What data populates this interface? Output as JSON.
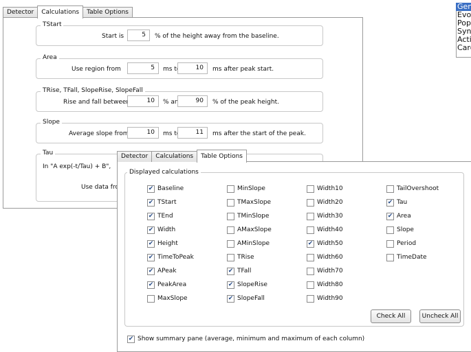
{
  "window1": {
    "tabs": [
      "Detector",
      "Calculations",
      "Table Options"
    ],
    "active_tab": 1,
    "groups": {
      "tstart": {
        "title": "TStart",
        "prefix": "Start is",
        "value": "5",
        "suffix": "% of the height away from the baseline."
      },
      "area": {
        "title": "Area",
        "prefix": "Use region from",
        "value1": "5",
        "middle": "ms to",
        "value2": "10",
        "suffix": "ms after peak start."
      },
      "trise": {
        "title": "TRise, TFall, SlopeRise, SlopeFall",
        "prefix": "Rise and fall between",
        "value1": "10",
        "middle": "% and",
        "value2": "90",
        "suffix": "% of the peak height."
      },
      "slope": {
        "title": "Slope",
        "prefix": "Average slope from",
        "value1": "10",
        "middle": "ms to",
        "value2": "11",
        "suffix": "ms after the start of the peak."
      },
      "tau": {
        "title": "Tau",
        "formula": "In  \"A exp(-t/Tau) + B\",",
        "use_data": "Use data fro"
      }
    }
  },
  "side_list": {
    "items": [
      "Gen",
      "Evo",
      "Pop",
      "Syn",
      "Acti",
      "Carc"
    ],
    "selected": 0
  },
  "window2": {
    "tabs": [
      "Detector",
      "Calculations",
      "Table Options"
    ],
    "active_tab": 2,
    "group_title": "Displayed calculations",
    "checkbox_columns": [
      [
        {
          "label": "Baseline",
          "checked": true
        },
        {
          "label": "TStart",
          "checked": true
        },
        {
          "label": "TEnd",
          "checked": true
        },
        {
          "label": "Width",
          "checked": true
        },
        {
          "label": "Height",
          "checked": true
        },
        {
          "label": "TimeToPeak",
          "checked": true
        },
        {
          "label": "APeak",
          "checked": true
        },
        {
          "label": "PeakArea",
          "checked": true
        },
        {
          "label": "MaxSlope",
          "checked": false
        }
      ],
      [
        {
          "label": "MinSlope",
          "checked": false
        },
        {
          "label": "TMaxSlope",
          "checked": false
        },
        {
          "label": "TMinSlope",
          "checked": false
        },
        {
          "label": "AMaxSlope",
          "checked": false
        },
        {
          "label": "AMinSlope",
          "checked": false
        },
        {
          "label": "TRise",
          "checked": false
        },
        {
          "label": "TFall",
          "checked": true
        },
        {
          "label": "SlopeRise",
          "checked": true
        },
        {
          "label": "SlopeFall",
          "checked": true
        }
      ],
      [
        {
          "label": "Width10",
          "checked": false
        },
        {
          "label": "Width20",
          "checked": false
        },
        {
          "label": "Width30",
          "checked": false
        },
        {
          "label": "Width40",
          "checked": false
        },
        {
          "label": "Width50",
          "checked": true
        },
        {
          "label": "Width60",
          "checked": false
        },
        {
          "label": "Width70",
          "checked": false
        },
        {
          "label": "Width80",
          "checked": false
        },
        {
          "label": "Width90",
          "checked": false
        }
      ],
      [
        {
          "label": "TailOvershoot",
          "checked": false
        },
        {
          "label": "Tau",
          "checked": true
        },
        {
          "label": "Area",
          "checked": true
        },
        {
          "label": "Slope",
          "checked": false
        },
        {
          "label": "Period",
          "checked": false
        },
        {
          "label": "TimeDate",
          "checked": false
        }
      ]
    ],
    "check_all_label": "Check All",
    "uncheck_all_label": "Uncheck All",
    "summary": {
      "label": "Show summary pane (average, minimum and maximum of each column)",
      "checked": true
    }
  },
  "colors": {
    "selection": "#3a6fc4",
    "check_mark": "#2b4f8a"
  }
}
